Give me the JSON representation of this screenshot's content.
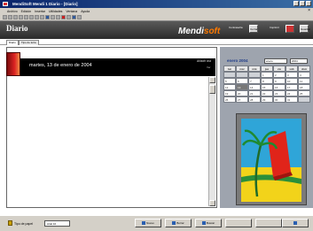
{
  "window": {
    "title": "MendiSoft Mendi 1 Diario - [Diario]"
  },
  "menu": {
    "items": [
      "Archivo",
      "Edición",
      "Insertar",
      "Utilidades",
      "Ventana",
      "Ayuda"
    ]
  },
  "header": {
    "title": "Diario",
    "brand_main": "Mendi",
    "brand_accent": "soft",
    "btn1_label": "Cerrar",
    "btn2_label": "",
    "btn3_label": "Guardar",
    "label1": "Contraseña",
    "label2": "Imprimir"
  },
  "tabs": [
    {
      "label": "Diario"
    },
    {
      "label": "Tipo de letra"
    }
  ],
  "entry": {
    "date_text": "martes, 13 de enero de 2004",
    "bar_label": "Añadir día",
    "bar_small": "Ver"
  },
  "calendar": {
    "month_title": "enero 2004",
    "month_select": "enero",
    "year_select": "2004",
    "weekdays": [
      "lun",
      "mar",
      "mié",
      "jue",
      "vie",
      "sáb",
      "dom"
    ],
    "rows": [
      [
        "",
        "",
        "",
        "1",
        "2",
        "3",
        "4"
      ],
      [
        "5",
        "6",
        "7",
        "8",
        "9",
        "10",
        "11"
      ],
      [
        "12",
        "13",
        "14",
        "15",
        "16",
        "17",
        "18"
      ],
      [
        "19",
        "20",
        "21",
        "22",
        "23",
        "24",
        "25"
      ],
      [
        "26",
        "27",
        "28",
        "29",
        "30",
        "31",
        ""
      ]
    ],
    "selected_day": "13"
  },
  "status": {
    "font_label": "Tipo de papel",
    "font_select": "Arial 10",
    "buttons": [
      "Nuevo",
      "Borrar",
      "Buscar",
      "",
      "",
      ""
    ]
  },
  "colors": {
    "header": "#3a3a3a",
    "brand_accent": "#ff7a00",
    "calendar_bg": "#9ea4ae",
    "date_bar": "#000000"
  },
  "icons": {
    "app": "diary-icon",
    "entry": "red-book-icon",
    "picture": "palm-tree-beach-icon"
  }
}
